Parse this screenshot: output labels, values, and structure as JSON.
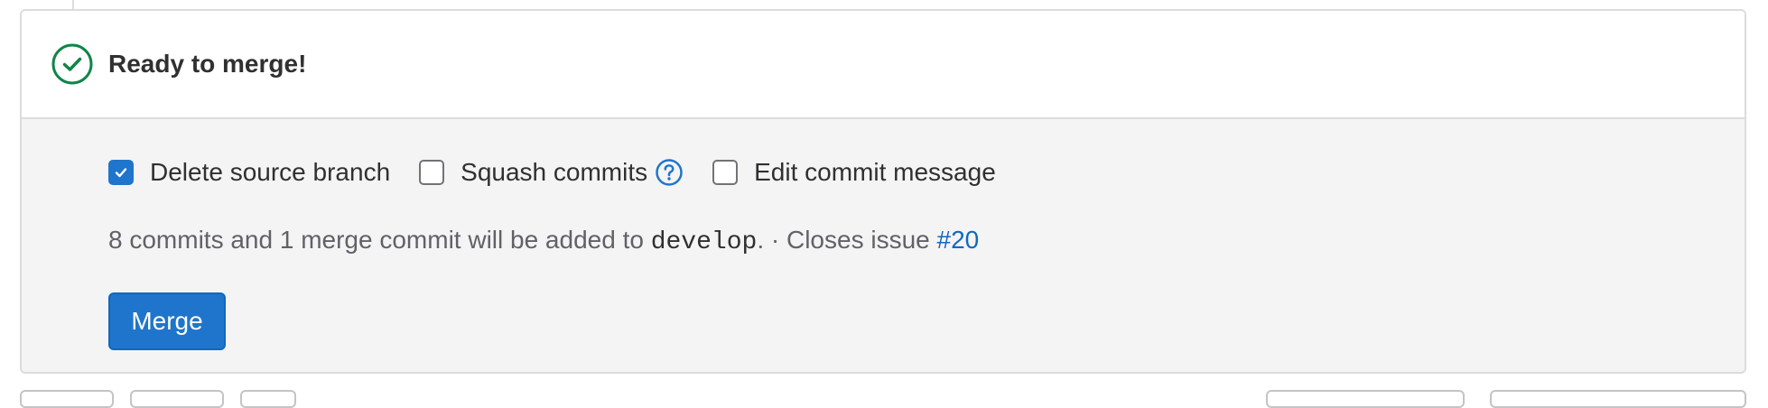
{
  "widget": {
    "status_title": "Ready to merge!",
    "status_icon": "check-circle-icon",
    "status_color": "#108548"
  },
  "options": [
    {
      "label": "Delete source branch",
      "checked": true
    },
    {
      "label": "Squash commits",
      "checked": false,
      "help_icon": "question-circle-icon"
    },
    {
      "label": "Edit commit message",
      "checked": false
    }
  ],
  "info": {
    "prefix": "8 commits and 1 merge commit will be added to ",
    "branch": "develop",
    "middle": ". · Closes issue ",
    "issue": "#20"
  },
  "merge_button": {
    "label": "Merge"
  },
  "colors": {
    "accent": "#1f75cb",
    "link": "#1068bf",
    "success": "#108548"
  }
}
